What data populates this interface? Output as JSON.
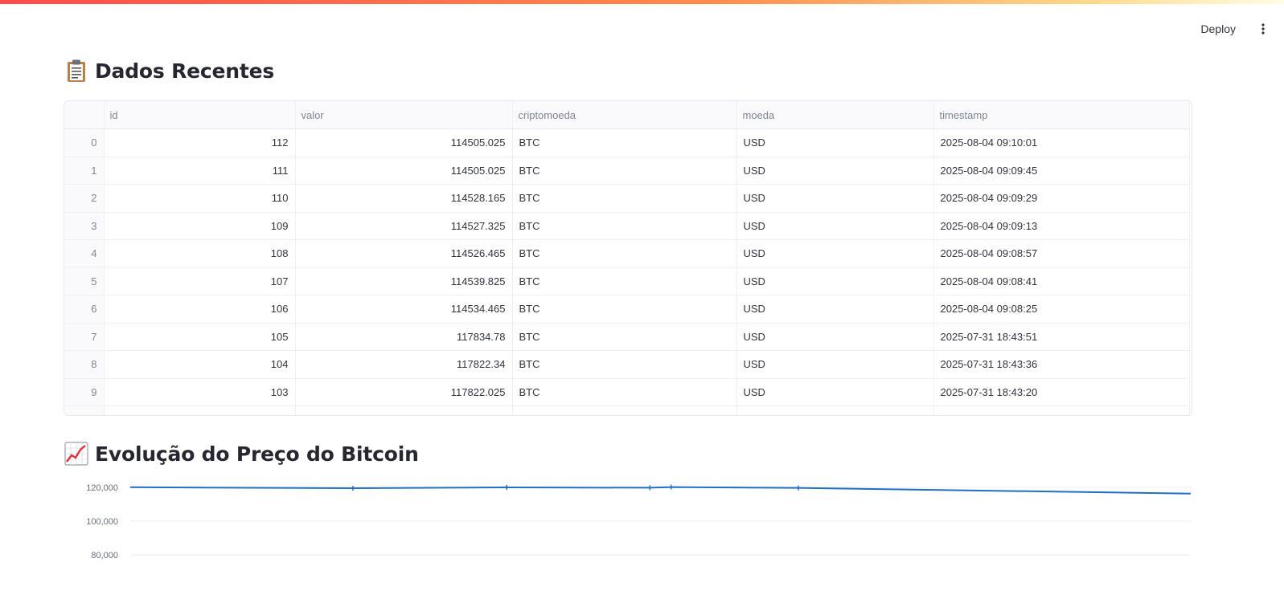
{
  "header": {
    "deploy_label": "Deploy",
    "menu_icon": "more-vert-icon"
  },
  "section_table": {
    "icon": "clipboard-icon",
    "title": "Dados Recentes"
  },
  "table": {
    "columns": [
      "",
      "id",
      "valor",
      "criptomoeda",
      "moeda",
      "timestamp"
    ],
    "rows": [
      {
        "index": "0",
        "id": "112",
        "valor": "114505.025",
        "criptomoeda": "BTC",
        "moeda": "USD",
        "timestamp": "2025-08-04 09:10:01"
      },
      {
        "index": "1",
        "id": "111",
        "valor": "114505.025",
        "criptomoeda": "BTC",
        "moeda": "USD",
        "timestamp": "2025-08-04 09:09:45"
      },
      {
        "index": "2",
        "id": "110",
        "valor": "114528.165",
        "criptomoeda": "BTC",
        "moeda": "USD",
        "timestamp": "2025-08-04 09:09:29"
      },
      {
        "index": "3",
        "id": "109",
        "valor": "114527.325",
        "criptomoeda": "BTC",
        "moeda": "USD",
        "timestamp": "2025-08-04 09:09:13"
      },
      {
        "index": "4",
        "id": "108",
        "valor": "114526.465",
        "criptomoeda": "BTC",
        "moeda": "USD",
        "timestamp": "2025-08-04 09:08:57"
      },
      {
        "index": "5",
        "id": "107",
        "valor": "114539.825",
        "criptomoeda": "BTC",
        "moeda": "USD",
        "timestamp": "2025-08-04 09:08:41"
      },
      {
        "index": "6",
        "id": "106",
        "valor": "114534.465",
        "criptomoeda": "BTC",
        "moeda": "USD",
        "timestamp": "2025-08-04 09:08:25"
      },
      {
        "index": "7",
        "id": "105",
        "valor": "117834.78",
        "criptomoeda": "BTC",
        "moeda": "USD",
        "timestamp": "2025-07-31 18:43:51"
      },
      {
        "index": "8",
        "id": "104",
        "valor": "117822.34",
        "criptomoeda": "BTC",
        "moeda": "USD",
        "timestamp": "2025-07-31 18:43:36"
      },
      {
        "index": "9",
        "id": "103",
        "valor": "117822.025",
        "criptomoeda": "BTC",
        "moeda": "USD",
        "timestamp": "2025-07-31 18:43:20"
      }
    ]
  },
  "section_chart": {
    "icon": "chart-increasing-icon",
    "title": "Evolução do Preço do Bitcoin"
  },
  "chart_data": {
    "type": "line",
    "title": "",
    "xlabel": "",
    "ylabel": "",
    "ylim": [
      70000,
      122000
    ],
    "yticks": [
      80000,
      100000,
      120000
    ],
    "ytick_labels": [
      "80,000",
      "100,000",
      "120,000"
    ],
    "grid": true,
    "color": "#1f6fc5",
    "x": [
      0,
      0.21,
      0.355,
      0.49,
      0.51,
      0.63,
      1.0
    ],
    "values": [
      120100,
      119500,
      120000,
      119800,
      120200,
      119700,
      116300
    ]
  }
}
